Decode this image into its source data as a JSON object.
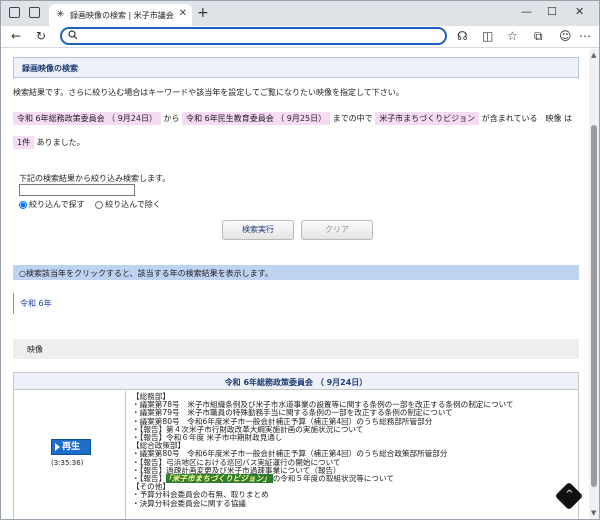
{
  "browser": {
    "tab_title": "録画映像の検索 | 米子市議会委員会",
    "address_value": "",
    "icons": [
      "workspaces-icon",
      "tabs-icon",
      "new-tab-icon",
      "back-icon",
      "refresh-icon",
      "search-icon",
      "read-aloud-icon",
      "split-screen-icon",
      "favorites-icon",
      "collections-icon",
      "profile-icon",
      "menu-icon"
    ]
  },
  "page": {
    "heading": "録画映像の検索",
    "intro": "検索結果です。さらに絞り込む場合はキーワードや該当年を設定してご覧になりたい映像を指定して下さい。",
    "from_meeting": "令和 6年総務政策委員会 （ 9月24日）",
    "word_from": "から",
    "to_meeting": "令和 6年民生教育委員会 （ 9月25日）",
    "word_until": "までの中で",
    "keyword": "米子市まちづくりビジョン",
    "word_included": "が含まれている　映像 は",
    "count": "1件",
    "word_found": "ありました。",
    "narrow_label": "下記の検索結果から絞り込み検索します。",
    "narrow_value": "",
    "radio_include": "絞り込んで探す",
    "radio_exclude": "絞り込んで除く",
    "search_button": "検索実行",
    "clear_button": "クリア",
    "notice": "○検索該当年をクリックすると、該当する年の検索結果を表示します。",
    "year_tab": "令和 6年",
    "video_section": "映像",
    "result": {
      "title": "令和 6年総務政策委員会 （ 9月24日）",
      "play_label": "再生",
      "duration": "(3:35:36)",
      "lines": [
        "【総務部】",
        "・議案第78号　米子市組織条例及び米子市水道事業の設置等に関する条例の一部を改正する条例の制定について",
        "・議案第79号　米子市職員の特殊勤務手当に関する条例の一部を改正する条例の制定について",
        "・議案第80号　令和6年度米子市一般会計補正予算（補正第4回）のうち総務部所管部分",
        "・【報告】第４次米子市行財政改革大綱実施計画の実施状況について",
        "・【報告】令和６年度 米子市中期財政見通し",
        "【総合政策部】",
        "・議案第80号　令和6年度米子市一般会計補正予算（補正第4回）のうち総合政策部所管部分",
        "・【報告】弓浜地区における巡回バス実証運行の開始について",
        "・【報告】過疎計画変更及び米子市過疎事業について（報告）"
      ],
      "highlight_pre": "・【報告】",
      "highlight": "「米子市まちづくりビジョン」",
      "highlight_post": "の令和５年度の取組状況等について",
      "lines_after": [
        "【その他】",
        "・予算分科会委員会の有無、取りまとめ",
        "・決算分科会委員会に関する協議"
      ]
    }
  }
}
